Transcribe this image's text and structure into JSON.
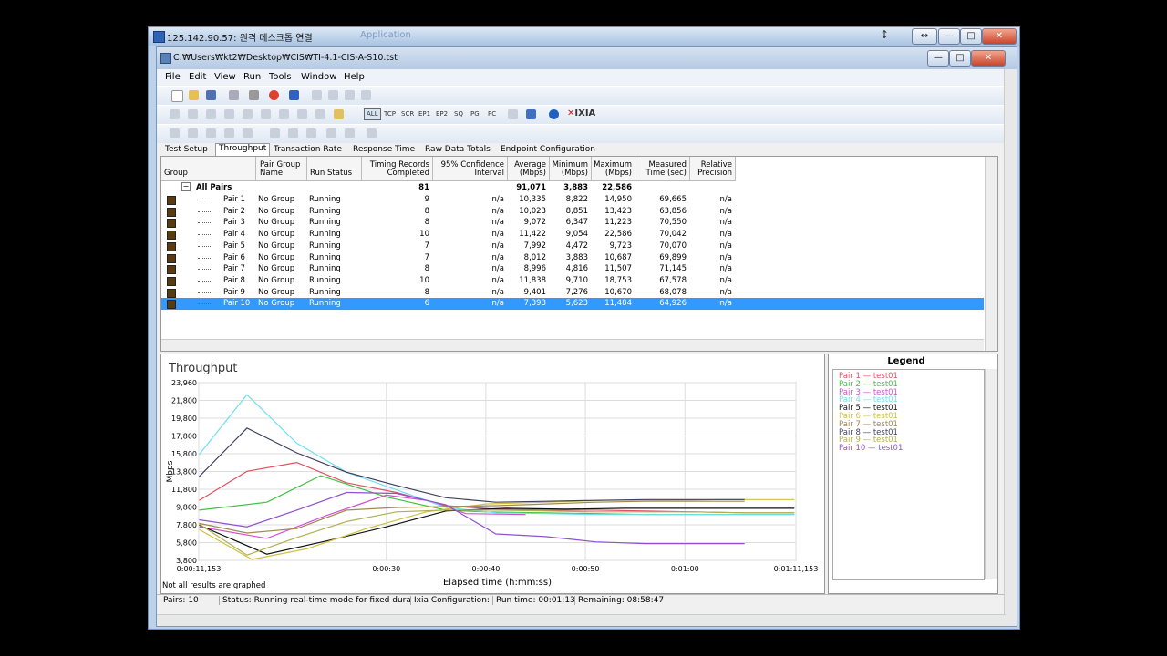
{
  "remote": {
    "title": "125.142.90.57: 원격 데스크톱 연결",
    "ghost_title": "Application",
    "buttons": [
      "↔",
      "—",
      "□",
      "✕"
    ]
  },
  "app": {
    "title": "C:₩Users₩kt2₩Desktop₩CIS₩TI-4.1-CIS-A-S10.tst",
    "buttons": [
      "—",
      "□",
      "✕"
    ]
  },
  "menu": [
    "File",
    "Edit",
    "View",
    "Run",
    "Tools",
    "Window",
    "Help"
  ],
  "toolbar2_labels": [
    "ALL",
    "TCP",
    "SCR",
    "EP1",
    "EP2",
    "SQ",
    "PG",
    "PC"
  ],
  "brand": "IXIA",
  "tabs": [
    "Test Setup",
    "Throughput",
    "Transaction Rate",
    "Response Time",
    "Raw Data Totals",
    "Endpoint Configuration"
  ],
  "active_tab": 1,
  "grid": {
    "headers": [
      "Group",
      "Pair Group Name",
      "Run Status",
      "Timing Records Completed",
      "95% Confidence Interval",
      "Average (Mbps)",
      "Minimum (Mbps)",
      "Maximum (Mbps)",
      "Measured Time (sec)",
      "Relative Precision"
    ],
    "summary": {
      "label": "All Pairs",
      "timing": "81",
      "avg": "91,071",
      "min": "3,883",
      "max": "22,586"
    },
    "rows": [
      {
        "pair": "Pair 1",
        "group": "No Group",
        "status": "Running",
        "timing": "9",
        "ci": "n/a",
        "avg": "10,335",
        "min": "8,822",
        "max": "14,950",
        "time": "69,665",
        "prec": "n/a"
      },
      {
        "pair": "Pair 2",
        "group": "No Group",
        "status": "Running",
        "timing": "8",
        "ci": "n/a",
        "avg": "10,023",
        "min": "8,851",
        "max": "13,423",
        "time": "63,856",
        "prec": "n/a"
      },
      {
        "pair": "Pair 3",
        "group": "No Group",
        "status": "Running",
        "timing": "8",
        "ci": "n/a",
        "avg": "9,072",
        "min": "6,347",
        "max": "11,223",
        "time": "70,550",
        "prec": "n/a"
      },
      {
        "pair": "Pair 4",
        "group": "No Group",
        "status": "Running",
        "timing": "10",
        "ci": "n/a",
        "avg": "11,422",
        "min": "9,054",
        "max": "22,586",
        "time": "70,042",
        "prec": "n/a"
      },
      {
        "pair": "Pair 5",
        "group": "No Group",
        "status": "Running",
        "timing": "7",
        "ci": "n/a",
        "avg": "7,992",
        "min": "4,472",
        "max": "9,723",
        "time": "70,070",
        "prec": "n/a"
      },
      {
        "pair": "Pair 6",
        "group": "No Group",
        "status": "Running",
        "timing": "7",
        "ci": "n/a",
        "avg": "8,012",
        "min": "3,883",
        "max": "10,687",
        "time": "69,899",
        "prec": "n/a"
      },
      {
        "pair": "Pair 7",
        "group": "No Group",
        "status": "Running",
        "timing": "8",
        "ci": "n/a",
        "avg": "8,996",
        "min": "4,816",
        "max": "11,507",
        "time": "71,145",
        "prec": "n/a"
      },
      {
        "pair": "Pair 8",
        "group": "No Group",
        "status": "Running",
        "timing": "10",
        "ci": "n/a",
        "avg": "11,838",
        "min": "9,710",
        "max": "18,753",
        "time": "67,578",
        "prec": "n/a"
      },
      {
        "pair": "Pair 9",
        "group": "No Group",
        "status": "Running",
        "timing": "8",
        "ci": "n/a",
        "avg": "9,401",
        "min": "7,276",
        "max": "10,670",
        "time": "68,078",
        "prec": "n/a"
      },
      {
        "pair": "Pair 10",
        "group": "No Group",
        "status": "Running",
        "timing": "6",
        "ci": "n/a",
        "avg": "7,393",
        "min": "5,623",
        "max": "11,484",
        "time": "64,926",
        "prec": "n/a"
      }
    ],
    "selected_row": 9
  },
  "chart_data": {
    "type": "line",
    "title": "Throughput",
    "xlabel": "Elapsed time (h:mm:ss)",
    "ylabel": "Mbps",
    "x_ticks": [
      "0:00:11,153",
      "0:00:30",
      "0:00:40",
      "0:00:50",
      "0:01:00",
      "0:01:11,153"
    ],
    "x_tick_seconds": [
      11.153,
      30,
      40,
      50,
      60,
      71.153
    ],
    "xlim": [
      11.153,
      71.153
    ],
    "y_ticks": [
      "23,960",
      "21,800",
      "19,800",
      "17,800",
      "15,800",
      "13,800",
      "11,800",
      "9,800",
      "7,800",
      "5,800",
      "3,800"
    ],
    "ylim": [
      3800,
      23960
    ],
    "grid": true,
    "note": "Not all results are graphed",
    "series": [
      {
        "name": "Pair 1",
        "color": "#e05060",
        "x": [
          11.2,
          16,
          21,
          26,
          31,
          36,
          41,
          46,
          51,
          56,
          61,
          66,
          71
        ],
        "y": [
          10600,
          13900,
          14900,
          12600,
          11500,
          10000,
          9600,
          9500,
          9500,
          9400,
          9300,
          9200,
          9200
        ]
      },
      {
        "name": "Pair 2",
        "color": "#40c040",
        "x": [
          11.2,
          18,
          23.4,
          30,
          36,
          40,
          46,
          51,
          56,
          61,
          66,
          71
        ],
        "y": [
          9500,
          10400,
          13400,
          11000,
          9500,
          9300,
          9200,
          9100,
          9000,
          9000,
          9000,
          9000
        ]
      },
      {
        "name": "Pair 3",
        "color": "#d050d0",
        "x": [
          11.2,
          18,
          24,
          30,
          34,
          38,
          44
        ],
        "y": [
          7600,
          6300,
          8900,
          11200,
          10600,
          9100,
          9000
        ]
      },
      {
        "name": "Pair 4",
        "color": "#70e0f0",
        "x": [
          11.2,
          16,
          21,
          26,
          31,
          36,
          41,
          46,
          51,
          56,
          61,
          66,
          71
        ],
        "y": [
          15800,
          22600,
          17100,
          13800,
          11800,
          9800,
          9200,
          9100,
          9000,
          9000,
          9000,
          9000,
          9000
        ]
      },
      {
        "name": "Pair 5",
        "color": "#111111",
        "x": [
          11.2,
          18,
          24,
          30,
          36,
          42,
          48,
          54,
          60,
          66,
          71
        ],
        "y": [
          7800,
          4500,
          6000,
          7600,
          9400,
          9700,
          9600,
          9700,
          9700,
          9700,
          9700
        ]
      },
      {
        "name": "Pair 6",
        "color": "#d0c040",
        "x": [
          11.2,
          16.5,
          22,
          28,
          34,
          40,
          46,
          52,
          58,
          64,
          71
        ],
        "y": [
          7300,
          3900,
          5100,
          7400,
          9300,
          10200,
          10400,
          10600,
          10600,
          10700,
          10700
        ]
      },
      {
        "name": "Pair 7",
        "color": "#a08850",
        "x": [
          11.2,
          16,
          21,
          26,
          31,
          36,
          41,
          46,
          51,
          56,
          61,
          66
        ],
        "y": [
          8000,
          6900,
          7400,
          9500,
          9800,
          9900,
          10000,
          10200,
          10400,
          10500,
          10500,
          10500
        ]
      },
      {
        "name": "Pair 8",
        "color": "#404060",
        "x": [
          11.2,
          16,
          21,
          26,
          31,
          36,
          41,
          46,
          51,
          56,
          61,
          66
        ],
        "y": [
          13300,
          18800,
          16000,
          13800,
          12300,
          10900,
          10400,
          10500,
          10600,
          10700,
          10700,
          10700
        ]
      },
      {
        "name": "Pair 9",
        "color": "#b0b050",
        "x": [
          11.2,
          16,
          21,
          26,
          31,
          36,
          41,
          46,
          51,
          56,
          61,
          66,
          71
        ],
        "y": [
          7900,
          4400,
          6400,
          8200,
          9300,
          9500,
          9500,
          9400,
          9300,
          9300,
          9300,
          9200,
          9200
        ]
      },
      {
        "name": "Pair 10",
        "color": "#9050d0",
        "x": [
          11.2,
          16,
          21,
          26,
          31,
          36,
          41,
          46,
          51,
          56,
          61,
          66
        ],
        "y": [
          8400,
          7600,
          9500,
          11500,
          11400,
          10100,
          6800,
          6500,
          5900,
          5700,
          5700,
          5700
        ]
      }
    ]
  },
  "legend": {
    "title": "Legend",
    "items": [
      {
        "label": "Pair 1 — test01",
        "color": "#e05060"
      },
      {
        "label": "Pair 2 — test01",
        "color": "#40c040"
      },
      {
        "label": "Pair 3 — test01",
        "color": "#d050d0"
      },
      {
        "label": "Pair 4 — test01",
        "color": "#70e0f0"
      },
      {
        "label": "Pair 5 — test01",
        "color": "#111111"
      },
      {
        "label": "Pair 6 — test01",
        "color": "#d0c040"
      },
      {
        "label": "Pair 7 — test01",
        "color": "#a08850"
      },
      {
        "label": "Pair 8 — test01",
        "color": "#404060"
      },
      {
        "label": "Pair 9 — test01",
        "color": "#b0b050"
      },
      {
        "label": "Pair 10 — test01",
        "color": "#9050d0"
      }
    ]
  },
  "status": {
    "pairs": "Pairs: 10",
    "status": "Status: Running real-time mode for fixed dura",
    "ixia": "Ixia Configuration:",
    "runtime": "Run time: 00:01:13",
    "remaining": "Remaining: 08:58:47"
  }
}
